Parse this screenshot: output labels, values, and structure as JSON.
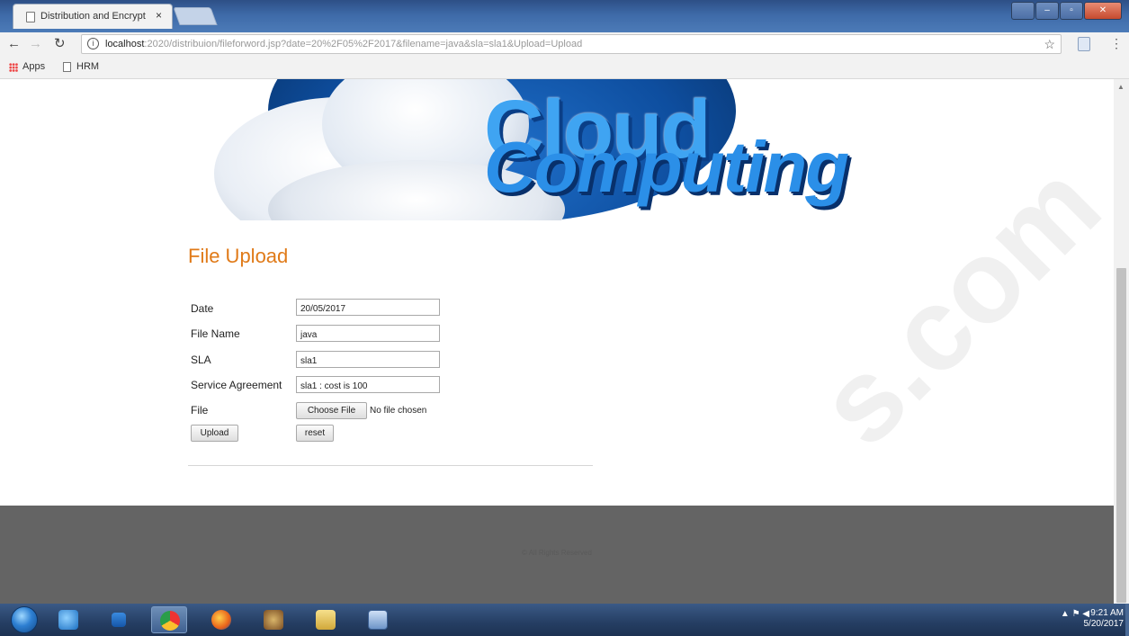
{
  "browser": {
    "tab_title": "Distribution and Encrypt",
    "tab_close": "×",
    "url_host": "localhost",
    "url_rest": ":2020/distribuion/fileforword.jsp?date=20%2F05%2F2017&filename=java&sla=sla1&Upload=Upload",
    "bookmarks": [
      {
        "label": "Apps"
      },
      {
        "label": "HRM"
      }
    ]
  },
  "banner": {
    "line1": "Cloud",
    "line2": "Computing"
  },
  "form": {
    "title": "File Upload",
    "date_label": "Date",
    "date_value": "20/05/2017",
    "filename_label": "File Name",
    "filename_value": "java",
    "sla_label": "SLA",
    "sla_value": "sla1",
    "agreement_label": "Service Agreement",
    "agreement_value": "sla1 : cost is 100",
    "file_label": "File",
    "choose_file_label": "Choose File",
    "no_file_text": "No file chosen",
    "upload_label": "Upload",
    "reset_label": "reset"
  },
  "footer": {
    "text": "© All Rights Reserved"
  },
  "watermark": {
    "text": "s.com"
  },
  "taskbar": {
    "time": "9:21 AM",
    "date": "5/20/2017"
  }
}
